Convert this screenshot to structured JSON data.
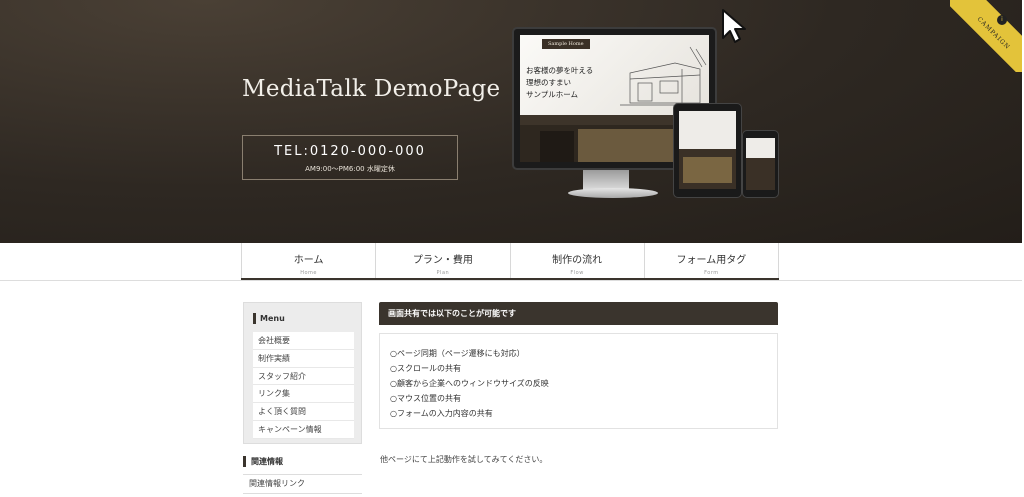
{
  "header": {
    "site_title": "MediaTalk DemoPage",
    "tel": "TEL:0120-000-000",
    "hours": "AM9:00～PM6:00  水曜定休",
    "campaign_label": "CAMPAIGN",
    "mockup": {
      "logo": "Sample Home",
      "catch_lines": [
        "お客様の夢を叶える",
        "理想のすまい",
        "サンプルホーム"
      ]
    }
  },
  "nav": {
    "items": [
      {
        "label": "ホーム",
        "sub": "Home"
      },
      {
        "label": "プラン・費用",
        "sub": "Plan"
      },
      {
        "label": "制作の流れ",
        "sub": "Flow"
      },
      {
        "label": "フォーム用タグ",
        "sub": "Form"
      }
    ]
  },
  "sidebar": {
    "menu_title": "Menu",
    "items": [
      {
        "label": "会社概要"
      },
      {
        "label": "制作実績"
      },
      {
        "label": "スタッフ紹介"
      },
      {
        "label": "リンク集"
      },
      {
        "label": "よく頂く質問"
      },
      {
        "label": "キャンペーン情報"
      }
    ],
    "related_title": "関連情報",
    "related_link": "関連情報リンク"
  },
  "main": {
    "heading": "画面共有では以下のことが可能です",
    "features": [
      "○ページ同期（ページ遷移にも対応）",
      "○スクロールの共有",
      "○顧客から企業へのウィンドウサイズの反映",
      "○マウス位置の共有",
      "○フォームの入力内容の共有"
    ],
    "note": "他ページにて上記動作を試してみてください。"
  },
  "colors": {
    "header_bg": "#2e2822",
    "accent_dark": "#3a342d",
    "campaign_gold": "#e3c33a"
  },
  "icons": {
    "cursor": "mouse-pointer-icon"
  }
}
